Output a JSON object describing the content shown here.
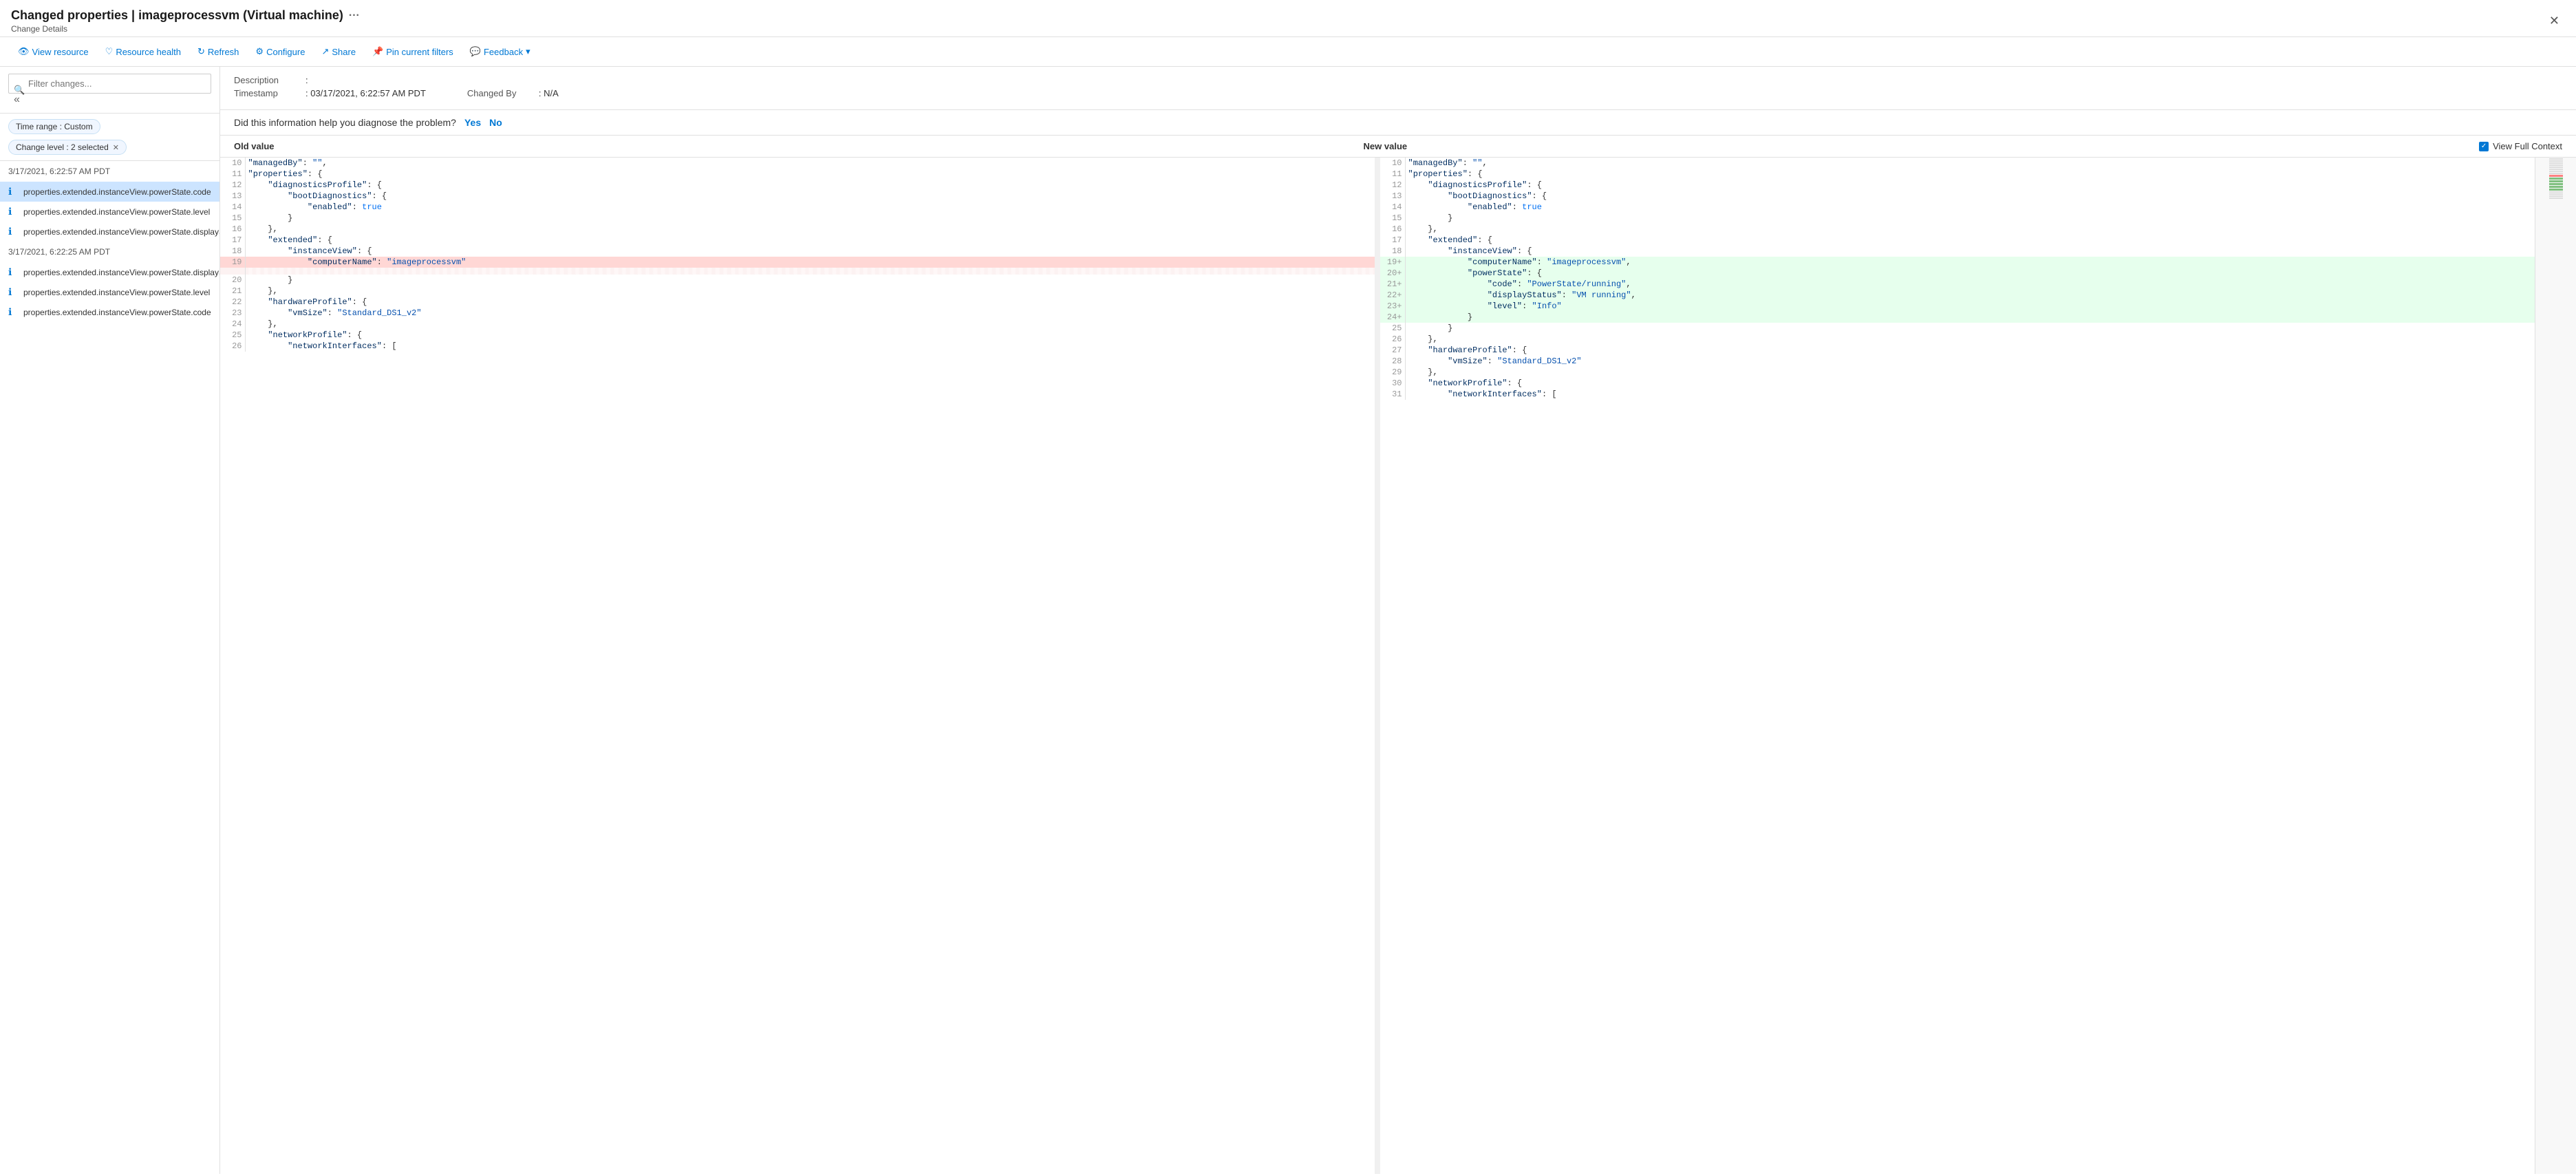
{
  "title": {
    "main": "Changed properties | imageprocessvm (Virtual machine)",
    "sub": "Change Details",
    "ellipsis": "···"
  },
  "toolbar": {
    "view_resource": "View resource",
    "resource_health": "Resource health",
    "refresh": "Refresh",
    "configure": "Configure",
    "share": "Share",
    "pin_current_filters": "Pin current filters",
    "feedback": "Feedback"
  },
  "search": {
    "placeholder": "Filter changes..."
  },
  "chips": {
    "time_range": "Time range : Custom",
    "change_level": "Change level : 2 selected"
  },
  "changes": {
    "group1": {
      "date": "3/17/2021, 6:22:57 AM PDT",
      "items": [
        "properties.extended.instanceView.powerState.code",
        "properties.extended.instanceView.powerState.level",
        "properties.extended.instanceView.powerState.displayStatus"
      ]
    },
    "group2": {
      "date": "3/17/2021, 6:22:25 AM PDT",
      "items": [
        "properties.extended.instanceView.powerState.displayStatus",
        "properties.extended.instanceView.powerState.level",
        "properties.extended.instanceView.powerState.code"
      ]
    }
  },
  "detail": {
    "description_label": "Description",
    "description_value": ":",
    "timestamp_label": "Timestamp",
    "timestamp_value": ": 03/17/2021, 6:22:57 AM PDT",
    "changed_by_label": "Changed By",
    "changed_by_value": ": N/A",
    "feedback_question": "Did this information help you diagnose the problem?",
    "feedback_yes": "Yes",
    "feedback_no": "No"
  },
  "diff": {
    "old_value_label": "Old value",
    "new_value_label": "New value",
    "view_full_context": "View Full Context"
  }
}
